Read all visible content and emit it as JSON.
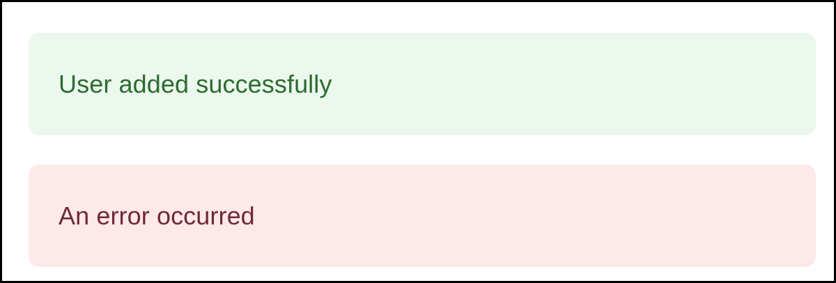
{
  "alerts": {
    "success": {
      "message": "User added successfully",
      "background": "#ecf7ed",
      "text_color": "#2b6c2f"
    },
    "error": {
      "message": "An error occurred",
      "background": "#fde8ea",
      "text_color": "#6f2a34"
    }
  }
}
